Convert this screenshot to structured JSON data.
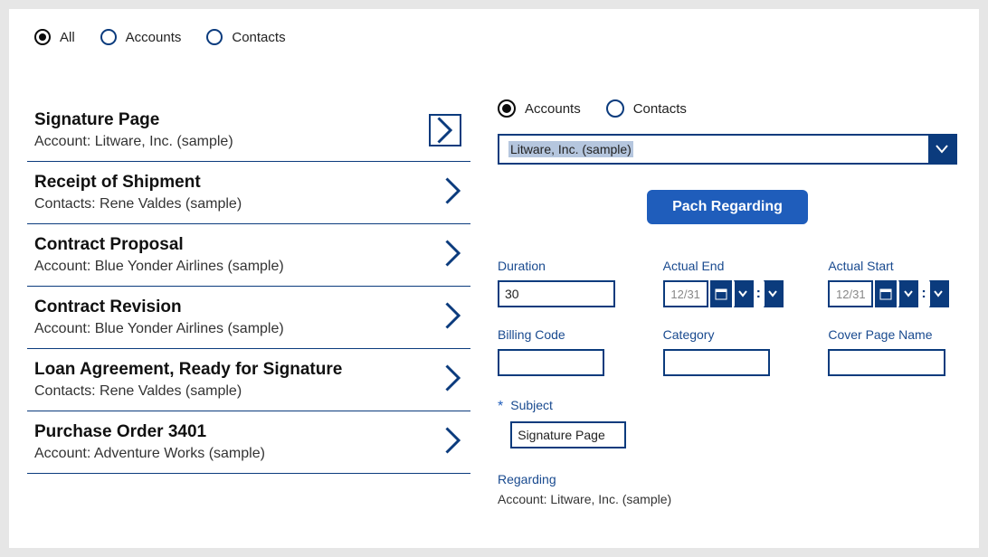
{
  "topFilters": {
    "all": "All",
    "accounts": "Accounts",
    "contacts": "Contacts",
    "selected": "all"
  },
  "list": [
    {
      "title": "Signature Page",
      "sub": "Account: Litware, Inc. (sample)",
      "selected": true
    },
    {
      "title": "Receipt of Shipment",
      "sub": "Contacts: Rene Valdes (sample)",
      "selected": false
    },
    {
      "title": "Contract Proposal",
      "sub": "Account: Blue Yonder Airlines (sample)",
      "selected": false
    },
    {
      "title": "Contract Revision",
      "sub": "Account: Blue Yonder Airlines (sample)",
      "selected": false
    },
    {
      "title": "Loan Agreement, Ready for Signature",
      "sub": "Contacts: Rene Valdes (sample)",
      "selected": false
    },
    {
      "title": "Purchase Order 3401",
      "sub": "Account: Adventure Works (sample)",
      "selected": false
    }
  ],
  "rightFilters": {
    "accounts": "Accounts",
    "contacts": "Contacts",
    "selected": "accounts"
  },
  "accountSelect": {
    "value": "Litware, Inc. (sample)"
  },
  "pachButton": "Pach Regarding",
  "fields": {
    "duration": {
      "label": "Duration",
      "value": "30"
    },
    "actualEnd": {
      "label": "Actual End",
      "value": "12/31"
    },
    "actualStart": {
      "label": "Actual Start",
      "value": "12/31"
    },
    "billingCode": {
      "label": "Billing Code",
      "value": ""
    },
    "category": {
      "label": "Category",
      "value": ""
    },
    "coverPageName": {
      "label": "Cover Page Name",
      "value": ""
    },
    "subject": {
      "label": "Subject",
      "value": "Signature Page",
      "required": true
    }
  },
  "regarding": {
    "label": "Regarding",
    "value": "Account: Litware, Inc. (sample)"
  }
}
